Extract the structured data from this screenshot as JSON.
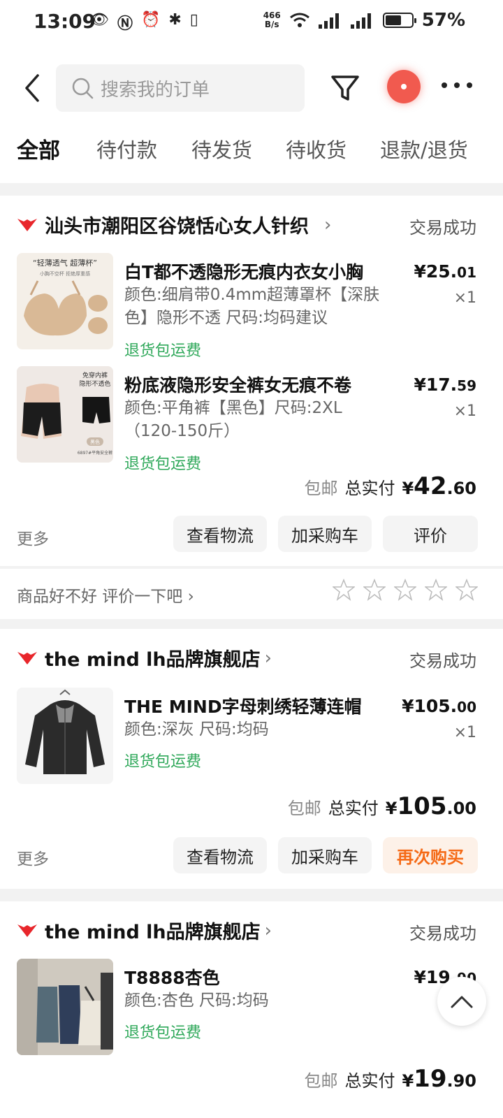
{
  "status_bar": {
    "time": "13:09",
    "net_speed_top": "466",
    "net_speed_bottom": "B/s",
    "battery": "57%"
  },
  "header": {
    "search_placeholder": "搜索我的订单"
  },
  "tabs": [
    {
      "label": "全部",
      "active": true
    },
    {
      "label": "待付款",
      "active": false
    },
    {
      "label": "待发货",
      "active": false
    },
    {
      "label": "待收货",
      "active": false
    },
    {
      "label": "退款/退货",
      "active": false
    }
  ],
  "orders": [
    {
      "shop": "汕头市潮阳区谷饶恬心女人针织",
      "status": "交易成功",
      "items": [
        {
          "title": "白T都不透隐形无痕内衣女小胸",
          "spec": "颜色:细肩带0.4mm超薄罩杯【深肤色】隐形不透 尺码:均码建议",
          "ret": "退货包运费",
          "price_int": "¥25.",
          "price_dec": "01",
          "qty": "×1",
          "thumb_top": "“轻薄透气 超薄杯”",
          "thumb_sub": "小胸不空杯 拒绝厚重感"
        },
        {
          "title": "粉底液隐形安全裤女无痕不卷",
          "spec": "颜色:平角裤【黑色】尺码:2XL（120-150斤）",
          "ret": "退货包运费",
          "price_int": "¥17.",
          "price_dec": "59",
          "qty": "×1",
          "thumb_top": "免穿内裤",
          "thumb_sub": "隐形不透色",
          "thumb_color": "黑色",
          "thumb_note": "6897#平角安全裤"
        }
      ],
      "ship": "包邮",
      "total_label": "总实付",
      "total_cur": "¥",
      "total_int": "42",
      "total_dec": ".60",
      "more": "更多",
      "buttons": [
        "查看物流",
        "加采购车",
        "评价"
      ],
      "rate_prompt": "商品好不好 评价一下吧"
    },
    {
      "shop": "the mind lh品牌旗舰店",
      "status": "交易成功",
      "items": [
        {
          "title": "THE MIND字母刺绣轻薄连帽",
          "spec": "颜色:深灰 尺码:均码",
          "ret": "退货包运费",
          "price_int": "¥105.",
          "price_dec": "00",
          "qty": "×1"
        }
      ],
      "ship": "包邮",
      "total_label": "总实付",
      "total_cur": "¥",
      "total_int": "105",
      "total_dec": ".00",
      "more": "更多",
      "buttons": [
        "查看物流",
        "加采购车",
        "再次购买"
      ]
    },
    {
      "shop": "the mind lh品牌旗舰店",
      "status": "交易成功",
      "items": [
        {
          "title": "T8888杏色",
          "spec": "颜色:杏色 尺码:均码",
          "ret": "退货包运费",
          "price_int": "¥19.",
          "price_dec": "90"
        }
      ],
      "ship": "包邮",
      "total_label": "总实付",
      "total_cur": "¥",
      "total_int": "19",
      "total_dec": ".90"
    }
  ],
  "colors": {
    "accent_orange": "#f56a16",
    "return_green": "#2fa85a",
    "shop_logo_red": "#e8262b"
  }
}
